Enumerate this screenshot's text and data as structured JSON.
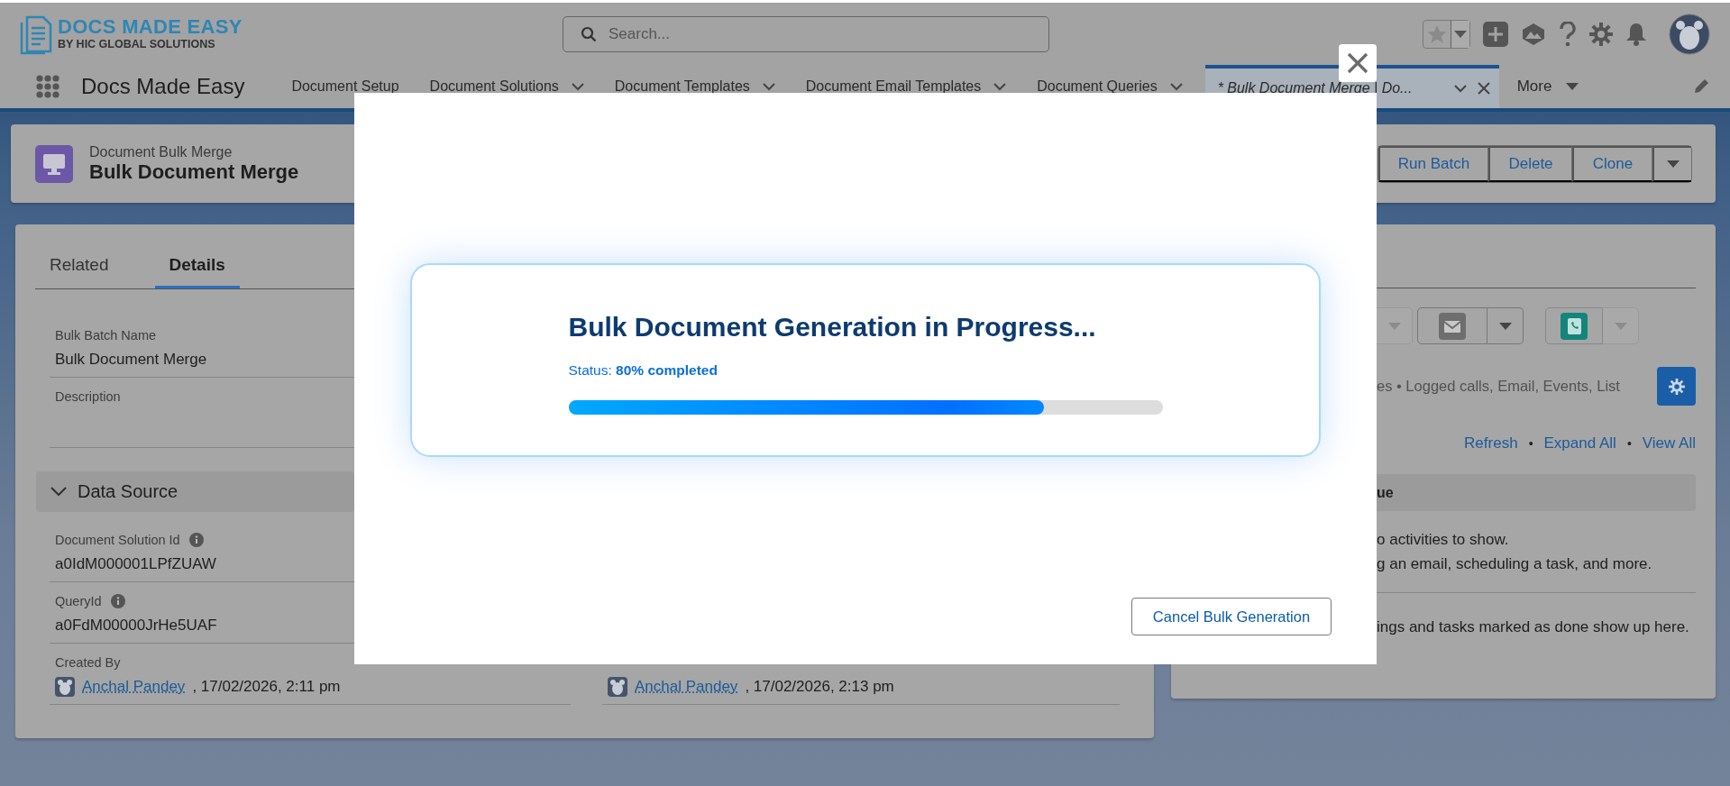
{
  "header": {
    "logo_title": "DOCS MADE EASY",
    "logo_subtitle": "BY HIC GLOBAL SOLUTIONS",
    "search": {
      "placeholder": "Search..."
    }
  },
  "nav": {
    "app_name": "Docs Made Easy",
    "items": [
      {
        "label": "Document Setup",
        "has_menu": false,
        "selected": false,
        "closable": false
      },
      {
        "label": "Document Solutions",
        "has_menu": true,
        "selected": false,
        "closable": false
      },
      {
        "label": "Document Templates",
        "has_menu": true,
        "selected": false,
        "closable": false
      },
      {
        "label": "Document Email Templates",
        "has_menu": true,
        "selected": false,
        "closable": false
      },
      {
        "label": "Document Queries",
        "has_menu": true,
        "selected": false,
        "closable": false
      },
      {
        "label": "* Bulk Document Merge | Do...",
        "has_menu": true,
        "selected": true,
        "closable": true
      }
    ],
    "more": "More"
  },
  "record": {
    "object": "Document Bulk Merge",
    "title": "Bulk Document Merge",
    "actions": [
      "Run Batch",
      "Delete",
      "Clone"
    ]
  },
  "details": {
    "tabs": [
      {
        "label": "Related",
        "selected": false
      },
      {
        "label": "Details",
        "selected": true
      }
    ],
    "fields": [
      {
        "label": "Bulk Batch Name",
        "value": "Bulk Document Merge",
        "info": false
      },
      {
        "label": "Description",
        "info": false
      }
    ],
    "section": {
      "title": "Data Source",
      "expanded": true,
      "fields": [
        {
          "label": "Document Solution Id",
          "value": "a0IdM000001LPfZUAW",
          "info": true
        },
        {
          "label": "QueryId",
          "value": "a0FdM00000JrHe5UAF",
          "info": true
        }
      ]
    },
    "created_by": {
      "label": "Created By",
      "user": "Anchal Pandey",
      "date": ", 17/02/2026, 2:11 pm"
    },
    "modified_by": {
      "user": "Anchal Pandey",
      "date": ", 17/02/2026, 2:13 pm"
    }
  },
  "activity": {
    "action_buttons": [
      {
        "kind": "partial",
        "menu_disabled": true
      },
      {
        "kind": "email",
        "menu_disabled": false
      },
      {
        "kind": "call",
        "menu_disabled": true
      }
    ],
    "filters_text": "es • Logged calls, Email, Events, List",
    "links": [
      {
        "label": "Refresh"
      },
      {
        "label": "Expand All"
      },
      {
        "label": "View All"
      }
    ],
    "separators": [
      "•",
      "•"
    ],
    "group_title": "ue",
    "empty_lines": [
      "o activities to show.",
      "g an email, scheduling a task, and more."
    ],
    "past_text": "ings and tasks marked as done show up here."
  },
  "modal": {
    "title": "Bulk Document Generation in Progress...",
    "status": "Status: **80% completed**",
    "level": 0.8,
    "cancel": "Cancel Bulk Generation"
  }
}
